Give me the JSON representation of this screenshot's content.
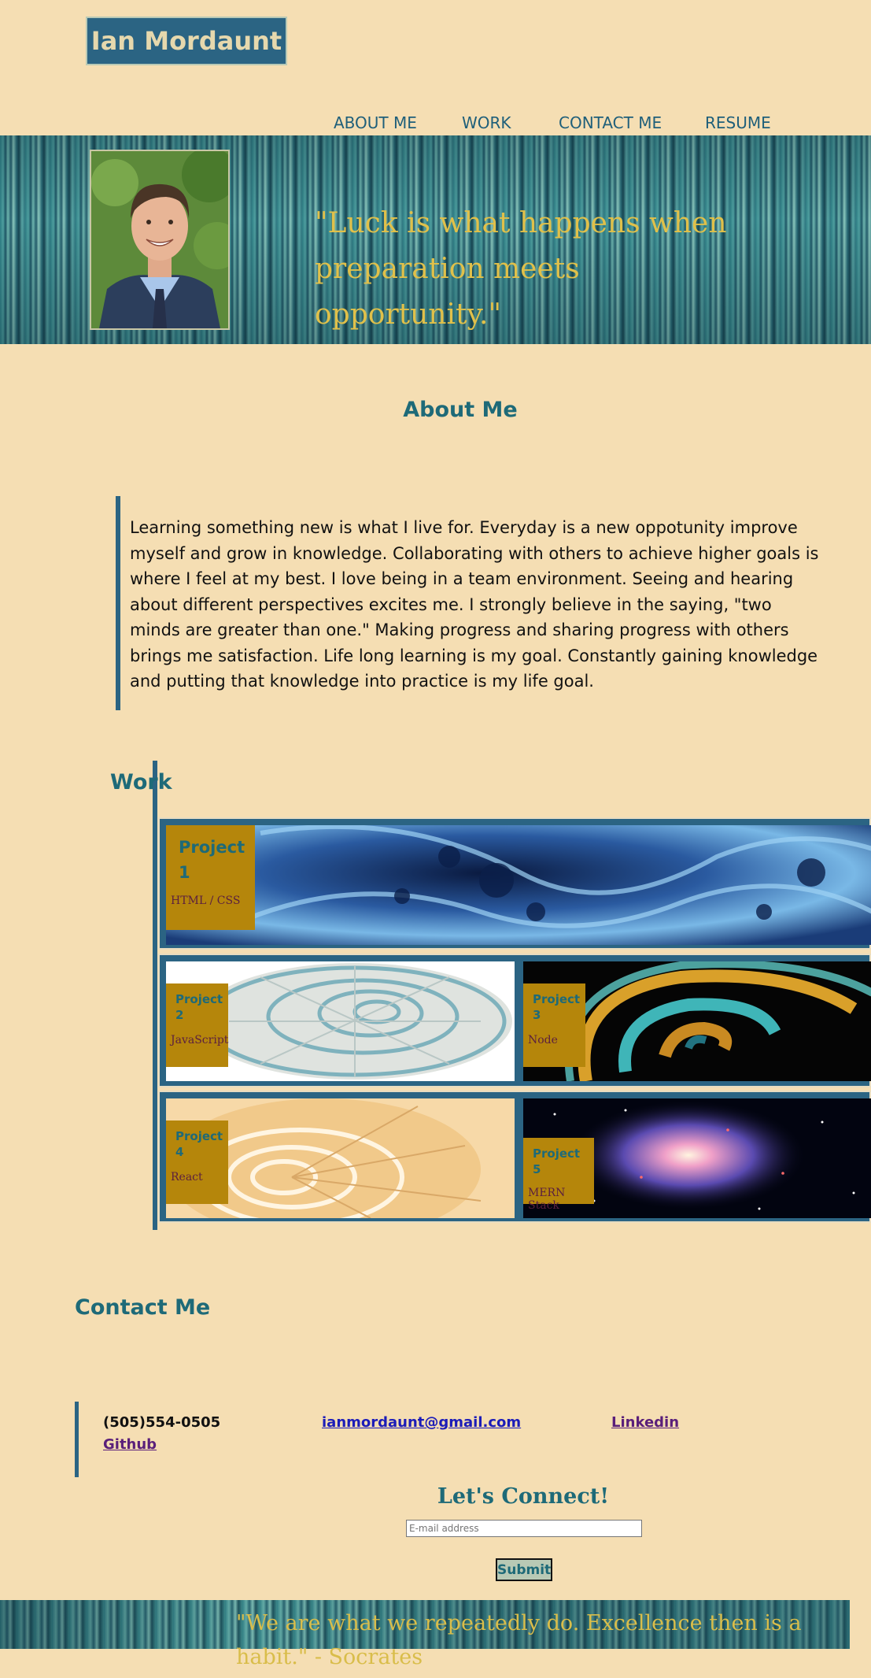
{
  "header": {
    "site_title": "Ian Mordaunt",
    "nav": [
      "ABOUT ME",
      "WORK",
      "CONTACT ME",
      "RESUME"
    ]
  },
  "hero": {
    "quote": "\"Luck is what happens when preparation meets opportunity.\""
  },
  "about": {
    "heading": "About Me",
    "text": "Learning something new is what I live for. Everyday is a new oppotunity improve myself and grow in knowledge. Collaborating with others to achieve higher goals is where I feel at my best. I love being in a team environment. Seeing and hearing about different perspectives excites me. I strongly believe in the saying, \"two minds are greater than one.\" Making progress and sharing progress with others brings me satisfaction. Life long learning is my goal. Constantly gaining knowledge and putting that knowledge into practice is my life goal."
  },
  "work": {
    "heading": "Work",
    "projects": [
      {
        "title": "Project 1",
        "tech": "HTML / CSS",
        "image": "blue-fractal-spiral"
      },
      {
        "title": "Project 2",
        "tech": "JavaScript",
        "image": "nautilus-shell-blue"
      },
      {
        "title": "Project 3",
        "tech": "Node",
        "image": "chameleon-tail-spiral"
      },
      {
        "title": "Project 4",
        "tech": "React",
        "image": "nautilus-shell-gold"
      },
      {
        "title": "Project 5",
        "tech": "MERN Stack",
        "image": "spiral-galaxy"
      }
    ]
  },
  "contact": {
    "heading": "Contact Me",
    "phone": "(505)554-0505",
    "email": "ianmordaunt@gmail.com",
    "linkedin": "Linkedin",
    "github": "Github",
    "connect_heading": "Let's Connect!",
    "email_placeholder": "E-mail address",
    "submit_label": "Submit"
  },
  "footer": {
    "quote": "\"We are what we repeatedly do. Excellence then is a habit.\" - Socrates"
  },
  "colors": {
    "background": "#f5deb3",
    "accent": "#2b6483",
    "heading": "#1e6a78",
    "tag": "#b5860b",
    "quote": "#e0c04a"
  }
}
